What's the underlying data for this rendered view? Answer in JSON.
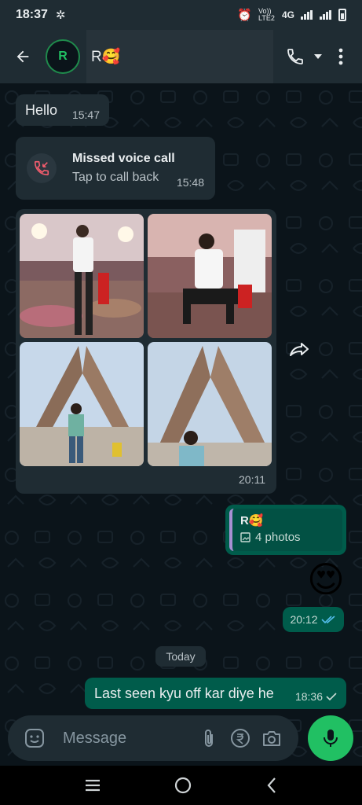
{
  "status": {
    "time": "18:37",
    "network_label": "Vo)) LTE2",
    "network_type": "4G"
  },
  "header": {
    "avatar_initial": "R",
    "contact_name": "R🥰"
  },
  "messages": {
    "hello": {
      "text": "Hello",
      "time": "15:47"
    },
    "missed_call": {
      "title": "Missed voice call",
      "subtitle": "Tap to call back",
      "time": "15:48"
    },
    "album": {
      "time": "20:11"
    },
    "quoted_reply": {
      "name": "R🥰",
      "photos": "4 photos"
    },
    "emoji": "😍",
    "emoji_time": "20:12",
    "date_divider": "Today",
    "last_message": {
      "text": "Last seen kyu off kar diye he",
      "time": "18:36"
    }
  },
  "composer": {
    "placeholder": "Message"
  },
  "colors": {
    "accent": "#21c063",
    "bubble_out": "#005c4b",
    "bubble_in": "#1f2c33",
    "read_tick": "#53bdeb"
  }
}
